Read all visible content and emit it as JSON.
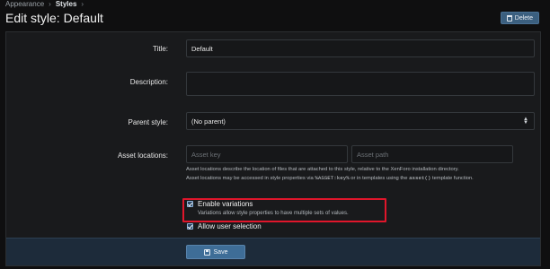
{
  "breadcrumb": {
    "items": [
      "Appearance",
      "Styles"
    ],
    "separator": "›"
  },
  "page": {
    "title": "Edit style: Default"
  },
  "actions": {
    "delete_label": "Delete"
  },
  "form": {
    "title": {
      "label": "Title:",
      "value": "Default"
    },
    "description": {
      "label": "Description:",
      "value": ""
    },
    "parent_style": {
      "label": "Parent style:",
      "value": "(No parent)"
    },
    "asset_locations": {
      "label": "Asset locations:",
      "key_placeholder": "Asset key",
      "path_placeholder": "Asset path",
      "hint_line1": "Asset locations describe the location of files that are attached to this style, relative to the XenForo installation directory.",
      "hint_line2_a": "Asset locations may be accessed in style properties via ",
      "hint_line2_code1": "%ASSET:key%",
      "hint_line2_b": " or in templates using the ",
      "hint_line2_code2": "asset()",
      "hint_line2_c": " template function."
    },
    "enable_variations": {
      "label": "Enable variations",
      "checked": true,
      "hint": "Variations allow style properties to have multiple sets of values."
    },
    "allow_user_selection": {
      "label": "Allow user selection",
      "checked": true
    }
  },
  "footer": {
    "save_label": "Save"
  },
  "colors": {
    "highlight": "#e0162b",
    "accent": "#3e6d97",
    "panel": "#191a1c"
  }
}
